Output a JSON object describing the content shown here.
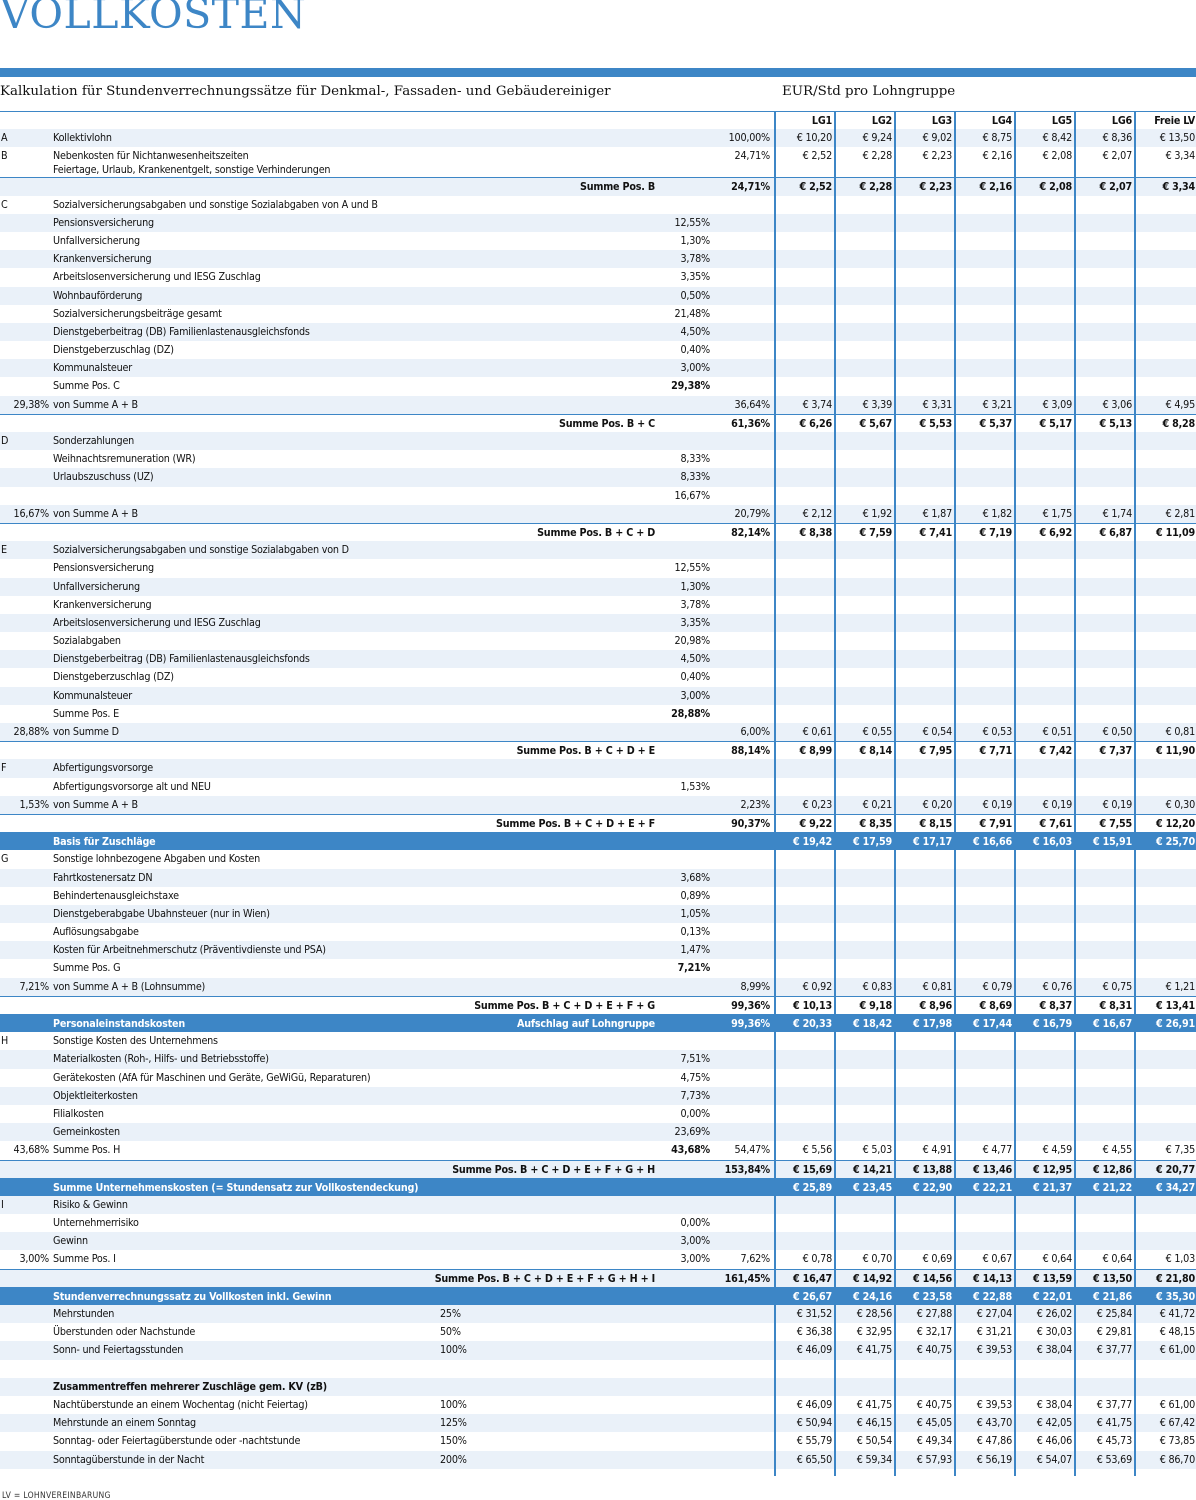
{
  "title": "VOLLKOSTEN",
  "subtitle": "Kalkulation für Stundenverrechnungssätze für Denkmal-, Fassaden- und Gebäudereiniger",
  "unit_label": "EUR/Std pro Lohngruppe",
  "columns": [
    "LG1",
    "LG2",
    "LG3",
    "LG4",
    "LG5",
    "LG6",
    "Freie LV"
  ],
  "footnote": "LV = LOHNVEREINBARUNG",
  "colors": {
    "accent": "#3d86c6",
    "alt_row": "#eaf1f9"
  },
  "rows": [
    {
      "t": "hdr"
    },
    {
      "k": "A",
      "l": "Kollektivlohn",
      "p2": "100,00%",
      "v": [
        "€ 10,20",
        "€ 9,24",
        "€ 9,02",
        "€ 8,75",
        "€ 8,42",
        "€ 8,36",
        "€ 13,50"
      ]
    },
    {
      "k": "B",
      "l": "Nebenkosten für Nichtanwesenheitszeiten",
      "l2": "Feiertage, Urlaub, Krankenentgelt, sonstige Verhinderungen",
      "p2": "24,71%",
      "v": [
        "€ 2,52",
        "€ 2,28",
        "€ 2,23",
        "€ 2,16",
        "€ 2,08",
        "€ 2,07",
        "€ 3,34"
      ],
      "t": "tall"
    },
    {
      "t": "sum",
      "l": "Summe Pos. B",
      "p2": "24,71%",
      "v": [
        "€ 2,52",
        "€ 2,28",
        "€ 2,23",
        "€ 2,16",
        "€ 2,08",
        "€ 2,07",
        "€ 3,34"
      ]
    },
    {
      "k": "C",
      "l": "Sozialversicherungsabgaben und sonstige Sozialabgaben von A und B"
    },
    {
      "l": "Pensionsversicherung",
      "p1": "12,55%"
    },
    {
      "l": "Unfallversicherung",
      "p1": "1,30%"
    },
    {
      "l": "Krankenversicherung",
      "p1": "3,78%"
    },
    {
      "l": "Arbeitslosenversicherung und IESG Zuschlag",
      "p1": "3,35%"
    },
    {
      "l": "Wohnbauförderung",
      "p1": "0,50%"
    },
    {
      "l": "Sozialversicherungsbeiträge gesamt",
      "p1": "21,48%"
    },
    {
      "l": "Dienstgeberbeitrag (DB) Familienlastenausgleichsfonds",
      "p1": "4,50%"
    },
    {
      "l": "Dienstgeberzuschlag (DZ)",
      "p1": "0,40%"
    },
    {
      "l": "Kommunalsteuer",
      "p1": "3,00%"
    },
    {
      "l": "Summe Pos. C",
      "p1": "29,38%",
      "p1b": true
    },
    {
      "k": "29,38%",
      "l": "von Summe A + B",
      "p2": "36,64%",
      "v": [
        "€ 3,74",
        "€ 3,39",
        "€ 3,31",
        "€ 3,21",
        "€ 3,09",
        "€ 3,06",
        "€ 4,95"
      ]
    },
    {
      "t": "sum",
      "l": "Summe Pos. B + C",
      "p2": "61,36%",
      "v": [
        "€ 6,26",
        "€ 5,67",
        "€ 5,53",
        "€ 5,37",
        "€ 5,17",
        "€ 5,13",
        "€ 8,28"
      ]
    },
    {
      "k": "D",
      "l": "Sonderzahlungen"
    },
    {
      "l": "Weihnachtsremuneration (WR)",
      "p1": "8,33%"
    },
    {
      "l": "Urlaubszuschuss (UZ)",
      "p1": "8,33%"
    },
    {
      "l": "",
      "p1": "16,67%"
    },
    {
      "k": "16,67%",
      "l": "von Summe A + B",
      "p2": "20,79%",
      "v": [
        "€ 2,12",
        "€ 1,92",
        "€ 1,87",
        "€ 1,82",
        "€ 1,75",
        "€ 1,74",
        "€ 2,81"
      ]
    },
    {
      "t": "sum",
      "l": "Summe Pos. B + C + D",
      "p2": "82,14%",
      "v": [
        "€ 8,38",
        "€ 7,59",
        "€ 7,41",
        "€ 7,19",
        "€ 6,92",
        "€ 6,87",
        "€ 11,09"
      ]
    },
    {
      "k": "E",
      "l": "Sozialversicherungsabgaben und sonstige Sozialabgaben von D"
    },
    {
      "l": "Pensionsversicherung",
      "p1": "12,55%"
    },
    {
      "l": "Unfallversicherung",
      "p1": "1,30%"
    },
    {
      "l": "Krankenversicherung",
      "p1": "3,78%"
    },
    {
      "l": "Arbeitslosenversicherung und IESG Zuschlag",
      "p1": "3,35%"
    },
    {
      "l": "Sozialabgaben",
      "p1": "20,98%"
    },
    {
      "l": "Dienstgeberbeitrag (DB) Familienlastenausgleichsfonds",
      "p1": "4,50%"
    },
    {
      "l": "Dienstgeberzuschlag (DZ)",
      "p1": "0,40%"
    },
    {
      "l": "Kommunalsteuer",
      "p1": "3,00%"
    },
    {
      "l": "Summe Pos. E",
      "p1": "28,88%",
      "p1b": true
    },
    {
      "k": "28,88%",
      "l": "von Summe D",
      "p2": "6,00%",
      "v": [
        "€ 0,61",
        "€ 0,55",
        "€ 0,54",
        "€ 0,53",
        "€ 0,51",
        "€ 0,50",
        "€ 0,81"
      ]
    },
    {
      "t": "sum",
      "l": "Summe Pos. B + C + D + E",
      "p2": "88,14%",
      "v": [
        "€ 8,99",
        "€ 8,14",
        "€ 7,95",
        "€ 7,71",
        "€ 7,42",
        "€ 7,37",
        "€ 11,90"
      ]
    },
    {
      "k": "F",
      "l": "Abfertigungsvorsorge"
    },
    {
      "l": "Abfertigungsvorsorge alt und NEU",
      "p1": "1,53%"
    },
    {
      "k": "1,53%",
      "l": "von Summe A + B",
      "p2": "2,23%",
      "v": [
        "€ 0,23",
        "€ 0,21",
        "€ 0,20",
        "€ 0,19",
        "€ 0,19",
        "€ 0,19",
        "€ 0,30"
      ]
    },
    {
      "t": "sum",
      "l": "Summe Pos. B + C + D + E + F",
      "p2": "90,37%",
      "v": [
        "€ 9,22",
        "€ 8,35",
        "€ 8,15",
        "€ 7,91",
        "€ 7,61",
        "€ 7,55",
        "€ 12,20"
      ]
    },
    {
      "t": "band",
      "l": "Basis für Zuschläge",
      "v": [
        "€ 19,42",
        "€ 17,59",
        "€ 17,17",
        "€ 16,66",
        "€ 16,03",
        "€ 15,91",
        "€ 25,70"
      ]
    },
    {
      "k": "G",
      "l": "Sonstige lohnbezogene Abgaben und Kosten"
    },
    {
      "l": "Fahrtkostenersatz DN",
      "p1": "3,68%"
    },
    {
      "l": "Behindertenausgleichstaxe",
      "p1": "0,89%"
    },
    {
      "l": "Dienstgeberabgabe Ubahnsteuer (nur in Wien)",
      "p1": "1,05%"
    },
    {
      "l": "Auflösungsabgabe",
      "p1": "0,13%"
    },
    {
      "l": "Kosten für Arbeitnehmerschutz (Präventivdienste und PSA)",
      "p1": "1,47%"
    },
    {
      "l": "Summe Pos. G",
      "p1": "7,21%",
      "p1b": true
    },
    {
      "k": "7,21%",
      "l": "von Summe A + B (Lohnsumme)",
      "p2": "8,99%",
      "v": [
        "€ 0,92",
        "€ 0,83",
        "€ 0,81",
        "€ 0,79",
        "€ 0,76",
        "€ 0,75",
        "€ 1,21"
      ]
    },
    {
      "t": "sum",
      "l": "Summe Pos. B + C + D + E + F + G",
      "p2": "99,36%",
      "v": [
        "€ 10,13",
        "€ 9,18",
        "€ 8,96",
        "€ 8,69",
        "€ 8,37",
        "€ 8,31",
        "€ 13,41"
      ]
    },
    {
      "t": "band",
      "l": "Personaleinstandskosten",
      "mid": "Aufschlag auf Lohngruppe",
      "p2": "99,36%",
      "v": [
        "€ 20,33",
        "€ 18,42",
        "€ 17,98",
        "€ 17,44",
        "€ 16,79",
        "€ 16,67",
        "€ 26,91"
      ]
    },
    {
      "k": "H",
      "l": "Sonstige Kosten des Unternehmens"
    },
    {
      "l": "Materialkosten (Roh-, Hilfs- und Betriebsstoffe)",
      "p1": "7,51%"
    },
    {
      "l": "Gerätekosten (AfA für Maschinen und Geräte, GeWiGü, Reparaturen)",
      "p1": "4,75%"
    },
    {
      "l": "Objektleiterkosten",
      "p1": "7,73%"
    },
    {
      "l": "Filialkosten",
      "p1": "0,00%"
    },
    {
      "l": "Gemeinkosten",
      "p1": "23,69%"
    },
    {
      "k": "43,68%",
      "l": "Summe Pos. H",
      "p1": "43,68%",
      "p1b": true,
      "p2": "54,47%",
      "v": [
        "€ 5,56",
        "€ 5,03",
        "€ 4,91",
        "€ 4,77",
        "€ 4,59",
        "€ 4,55",
        "€ 7,35"
      ]
    },
    {
      "t": "sum",
      "l": "Summe Pos. B + C + D + E + F + G + H",
      "p2": "153,84%",
      "v": [
        "€ 15,69",
        "€ 14,21",
        "€ 13,88",
        "€ 13,46",
        "€ 12,95",
        "€ 12,86",
        "€ 20,77"
      ]
    },
    {
      "t": "band",
      "l": "Summe Unternehmenskosten (= Stundensatz zur Vollkostendeckung)",
      "v": [
        "€ 25,89",
        "€ 23,45",
        "€ 22,90",
        "€ 22,21",
        "€ 21,37",
        "€ 21,22",
        "€ 34,27"
      ]
    },
    {
      "k": "I",
      "l": "Risiko & Gewinn"
    },
    {
      "l": "Unternehmerrisiko",
      "p1": "0,00%"
    },
    {
      "l": "Gewinn",
      "p1": "3,00%"
    },
    {
      "k": "3,00%",
      "l": "Summe Pos. I",
      "p1": "3,00%",
      "p2": "7,62%",
      "v": [
        "€ 0,78",
        "€ 0,70",
        "€ 0,69",
        "€ 0,67",
        "€ 0,64",
        "€ 0,64",
        "€ 1,03"
      ]
    },
    {
      "t": "sum",
      "l": "Summe Pos. B + C + D + E + F + G + H + I",
      "p2": "161,45%",
      "v": [
        "€ 16,47",
        "€ 14,92",
        "€ 14,56",
        "€ 14,13",
        "€ 13,59",
        "€ 13,50",
        "€ 21,80"
      ]
    },
    {
      "t": "band",
      "l": "Stundenverrechnungssatz zu Vollkosten inkl. Gewinn",
      "v": [
        "€ 26,67",
        "€ 24,16",
        "€ 23,58",
        "€ 22,88",
        "€ 22,01",
        "€ 21,86",
        "€ 35,30"
      ]
    },
    {
      "l": "Mehrstunden",
      "pct": "25%",
      "v": [
        "€ 31,52",
        "€ 28,56",
        "€ 27,88",
        "€ 27,04",
        "€ 26,02",
        "€ 25,84",
        "€ 41,72"
      ]
    },
    {
      "l": "Überstunden oder Nachstunde",
      "pct": "50%",
      "v": [
        "€ 36,38",
        "€ 32,95",
        "€ 32,17",
        "€ 31,21",
        "€ 30,03",
        "€ 29,81",
        "€ 48,15"
      ]
    },
    {
      "l": "Sonn- und Feiertagsstunden",
      "pct": "100%",
      "v": [
        "€ 46,09",
        "€ 41,75",
        "€ 40,75",
        "€ 39,53",
        "€ 38,04",
        "€ 37,77",
        "€ 61,00"
      ]
    },
    {
      "l": ""
    },
    {
      "l": "Zusammentreffen mehrerer Zuschläge gem. KV (zB)",
      "lb": true
    },
    {
      "l": "Nachtüberstunde an einem Wochentag (nicht Feiertag)",
      "pct": "100%",
      "v": [
        "€ 46,09",
        "€ 41,75",
        "€ 40,75",
        "€ 39,53",
        "€ 38,04",
        "€ 37,77",
        "€ 61,00"
      ]
    },
    {
      "l": "Mehrstunde an einem Sonntag",
      "pct": "125%",
      "v": [
        "€ 50,94",
        "€ 46,15",
        "€ 45,05",
        "€ 43,70",
        "€ 42,05",
        "€ 41,75",
        "€ 67,42"
      ]
    },
    {
      "l": "Sonntag- oder Feiertagüberstunde oder -nachtstunde",
      "pct": "150%",
      "v": [
        "€ 55,79",
        "€ 50,54",
        "€ 49,34",
        "€ 47,86",
        "€ 46,06",
        "€ 45,73",
        "€ 73,85"
      ]
    },
    {
      "l": "Sonntagüberstunde in der Nacht",
      "pct": "200%",
      "v": [
        "€ 65,50",
        "€ 59,34",
        "€ 57,93",
        "€ 56,19",
        "€ 54,07",
        "€ 53,69",
        "€ 86,70"
      ]
    }
  ]
}
